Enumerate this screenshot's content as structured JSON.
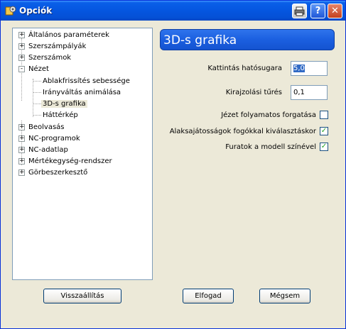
{
  "window": {
    "title": "Opciók"
  },
  "tree": {
    "items": [
      {
        "label": "Általános paraméterek",
        "state": "+"
      },
      {
        "label": "Szerszámpályák",
        "state": "+"
      },
      {
        "label": "Szerszámok",
        "state": "+"
      },
      {
        "label": "Nézet",
        "state": "-"
      },
      {
        "label": "Ablakfrissítés sebessége"
      },
      {
        "label": "Irányváltás animálása"
      },
      {
        "label": "3D-s grafika",
        "selected": true
      },
      {
        "label": "Háttérkép"
      },
      {
        "label": "Beolvasás",
        "state": "+"
      },
      {
        "label": "NC-programok",
        "state": "+"
      },
      {
        "label": "NC-adatlap",
        "state": "+"
      },
      {
        "label": "Mértékegység-rendszer",
        "state": "+"
      },
      {
        "label": "Görbeszerkesztő",
        "state": "+"
      }
    ]
  },
  "panel": {
    "title": "3D-s grafika",
    "fields": [
      {
        "label": "Kattintás hatósugara",
        "value": "5,0"
      },
      {
        "label": "Kirajzolási tűrés",
        "value": "0,1"
      }
    ],
    "checkboxes": [
      {
        "label": "Jézet folyamatos forgatása",
        "checked": false
      },
      {
        "label": "Alaksajátosságok fogókkal kiválasztáskor",
        "checked": true
      },
      {
        "label": "Furatok a modell színével",
        "checked": true
      }
    ]
  },
  "buttons": {
    "reset": "Visszaállítás",
    "ok": "Elfogad",
    "cancel": "Mégsem"
  },
  "icons": {
    "app": "app-icon",
    "print": "print-icon",
    "help": "help-icon",
    "close": "close-icon"
  },
  "colors": {
    "titlebar": "#0556e0",
    "header": "#1b5fe0",
    "checkmark": "#21a121"
  }
}
